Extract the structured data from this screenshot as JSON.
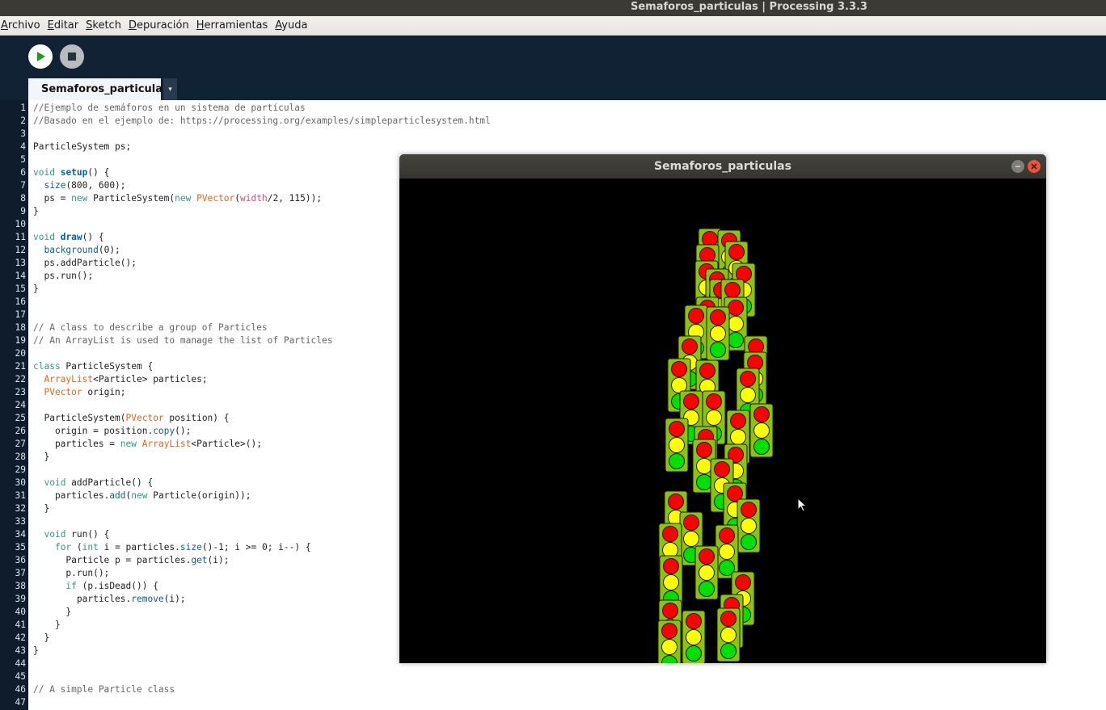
{
  "window": {
    "title": "Semaforos_particulas | Processing 3.3.3"
  },
  "menu": [
    {
      "mnemonic": "A",
      "rest": "rchivo"
    },
    {
      "mnemonic": "E",
      "rest": "ditar"
    },
    {
      "mnemonic": "S",
      "rest": "ketch"
    },
    {
      "mnemonic": "D",
      "rest": "epuración"
    },
    {
      "mnemonic": "H",
      "rest": "erramientas"
    },
    {
      "mnemonic": "A",
      "rest": "yuda"
    }
  ],
  "toolbar": {
    "run_icon": "play-icon",
    "stop_icon": "stop-icon"
  },
  "tabs": [
    {
      "label": "Semaforos_particulas"
    }
  ],
  "tab_menu_glyph": "▾",
  "editor": {
    "lines": [
      "//Ejemplo de semáforos en un sistema de partículas",
      "//Basado en el ejemplo de: https://processing.org/examples/simpleparticlesystem.html",
      "",
      "ParticleSystem ps;",
      "",
      "void setup() {",
      "  size(800, 600);",
      "  ps = new ParticleSystem(new PVector(width/2, 115));",
      "}",
      "",
      "void draw() {",
      "  background(0);",
      "  ps.addParticle();",
      "  ps.run();",
      "}",
      "",
      "",
      "// A class to describe a group of Particles",
      "// An ArrayList is used to manage the list of Particles",
      "",
      "class ParticleSystem {",
      "  ArrayList<Particle> particles;",
      "  PVector origin;",
      "",
      "  ParticleSystem(PVector position) {",
      "    origin = position.copy();",
      "    particles = new ArrayList<Particle>();",
      "  }",
      "",
      "  void addParticle() {",
      "    particles.add(new Particle(origin));",
      "  }",
      "",
      "  void run() {",
      "    for (int i = particles.size()-1; i >= 0; i--) {",
      "      Particle p = particles.get(i);",
      "      p.run();",
      "      if (p.isDead()) {",
      "        particles.remove(i);",
      "      }",
      "    }",
      "  }",
      "}",
      "",
      "",
      "// A simple Particle class",
      ""
    ]
  },
  "sketch_window": {
    "title": "Semaforos_particulas",
    "traffic_light_colors": {
      "body": "#8cc210",
      "red": "#ff0000",
      "yellow": "#ffff00",
      "green": "#00e000"
    }
  },
  "colors": {
    "keyword": "#33997e",
    "function": "#006699",
    "type": "#e2661a",
    "comment": "#666666",
    "method": "#0f5f8c"
  }
}
